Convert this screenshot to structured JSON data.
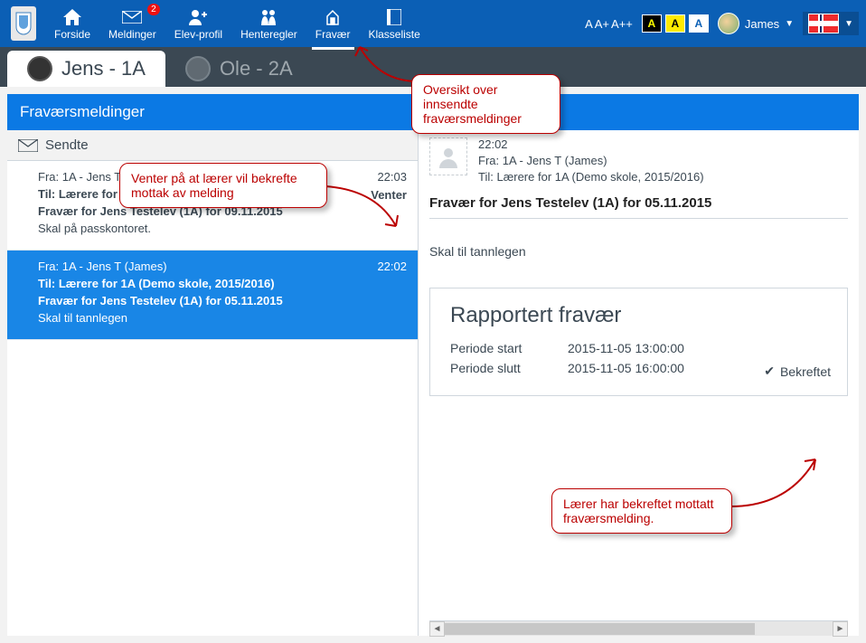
{
  "header": {
    "nav": [
      {
        "icon": "home",
        "label": "Forside"
      },
      {
        "icon": "mail",
        "label": "Meldinger",
        "badge": "2"
      },
      {
        "icon": "profile",
        "label": "Elev-profil"
      },
      {
        "icon": "rules",
        "label": "Henteregler"
      },
      {
        "icon": "absence",
        "label": "Fravær",
        "active": true
      },
      {
        "icon": "classlist",
        "label": "Klasseliste"
      }
    ],
    "font_sizes": [
      "A",
      "A+",
      "A++"
    ],
    "theme_letter": "A",
    "user_name": "James"
  },
  "tabs": [
    {
      "label": "Jens - 1A",
      "active": true
    },
    {
      "label": "Ole - 2A",
      "active": false
    }
  ],
  "card_title": "Fraværsmeldinger",
  "sendte_label": "Sendte",
  "messages": [
    {
      "from": "Fra: 1A - Jens T (James)",
      "to": "Til: Lærere for 1A (Demo skole, 2015/2016)",
      "subject": "Fravær for Jens Testelev (1A) for 09.11.2015",
      "preview": "Skal på passkontoret.",
      "time": "22:03",
      "status": "Venter",
      "selected": false
    },
    {
      "from": "Fra: 1A - Jens T (James)",
      "to": "Til: Lærere for 1A (Demo skole, 2015/2016)",
      "subject": "Fravær for Jens Testelev (1A) for 05.11.2015",
      "preview": "Skal til tannlegen",
      "time": "22:02",
      "status": "",
      "selected": true
    }
  ],
  "detail": {
    "time": "22:02",
    "from": "Fra: 1A - Jens T (James)",
    "to": "Til: Lærere for 1A (Demo skole, 2015/2016)",
    "subject": "Fravær for Jens Testelev (1A) for 05.11.2015",
    "body": "Skal til tannlegen",
    "report": {
      "title": "Rapportert fravær",
      "start_label": "Periode start",
      "start_val": "2015-11-05 13:00:00",
      "end_label": "Periode slutt",
      "end_val": "2015-11-05 16:00:00",
      "confirmed": "Bekreftet"
    }
  },
  "callouts": {
    "c1": "Oversikt over innsendte fraværsmeldinger",
    "c2": "Venter på at lærer vil bekrefte mottak av melding",
    "c3": "Lærer har bekreftet mottatt fraværsmelding."
  }
}
